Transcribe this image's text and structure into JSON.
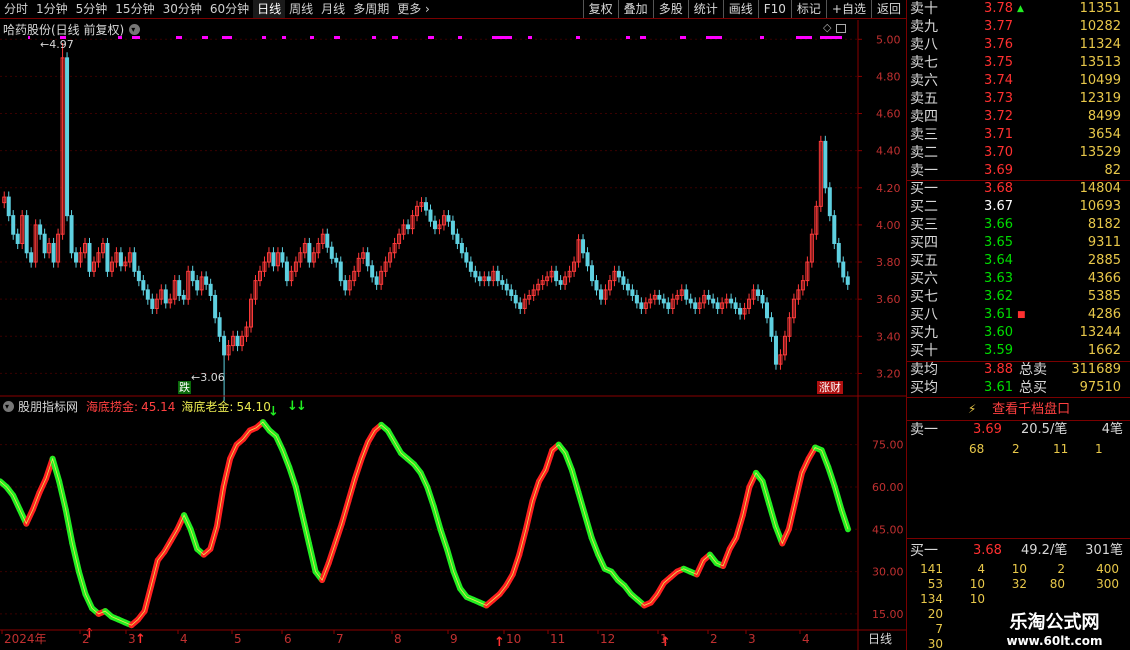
{
  "toolbar": {
    "timeframes": [
      "分时",
      "1分钟",
      "5分钟",
      "15分钟",
      "30分钟",
      "60分钟",
      "日线",
      "周线",
      "月线",
      "多周期",
      "更多"
    ],
    "active_timeframe": "日线",
    "buttons": [
      "复权",
      "叠加",
      "多股",
      "统计",
      "画线",
      "F10",
      "标记",
      "+自选",
      "返回"
    ]
  },
  "main": {
    "title": "哈药股份(日线 前复权)",
    "high_label": "4.97",
    "low_label": "3.06",
    "axis": [
      "5.00",
      "4.80",
      "4.60",
      "4.40",
      "4.20",
      "4.00",
      "3.80",
      "3.60",
      "3.40",
      "3.20"
    ],
    "tag_die": "跌",
    "tag_zhangcai": "涨财"
  },
  "indicator": {
    "name": "股朋指标网",
    "item1_label": "海底捞金:",
    "item1_value": "45.14",
    "item2_label": "海底老金:",
    "item2_value": "54.10",
    "axis": [
      "75.00",
      "60.00",
      "45.00",
      "30.00",
      "15.00"
    ]
  },
  "date_axis": {
    "labels": [
      "2024年",
      "2",
      "3",
      "4",
      "5",
      "6",
      "7",
      "8",
      "9",
      "10",
      "11",
      "12",
      "1",
      "2",
      "3",
      "4"
    ],
    "period": "日线"
  },
  "orderbook": {
    "asks": [
      {
        "label": "卖十",
        "price": "3.78",
        "vol": "11351",
        "mark": "▲"
      },
      {
        "label": "卖九",
        "price": "3.77",
        "vol": "10282"
      },
      {
        "label": "卖八",
        "price": "3.76",
        "vol": "11324"
      },
      {
        "label": "卖七",
        "price": "3.75",
        "vol": "13513"
      },
      {
        "label": "卖六",
        "price": "3.74",
        "vol": "10499"
      },
      {
        "label": "卖五",
        "price": "3.73",
        "vol": "12319"
      },
      {
        "label": "卖四",
        "price": "3.72",
        "vol": "8499"
      },
      {
        "label": "卖三",
        "price": "3.71",
        "vol": "3654"
      },
      {
        "label": "卖二",
        "price": "3.70",
        "vol": "13529"
      },
      {
        "label": "卖一",
        "price": "3.69",
        "vol": "82"
      }
    ],
    "bids": [
      {
        "label": "买一",
        "price": "3.68",
        "vol": "14804",
        "color": "red"
      },
      {
        "label": "买二",
        "price": "3.67",
        "vol": "10693",
        "color": "white"
      },
      {
        "label": "买三",
        "price": "3.66",
        "vol": "8182",
        "color": "green"
      },
      {
        "label": "买四",
        "price": "3.65",
        "vol": "9311",
        "color": "green"
      },
      {
        "label": "买五",
        "price": "3.64",
        "vol": "2885",
        "color": "green"
      },
      {
        "label": "买六",
        "price": "3.63",
        "vol": "4366",
        "color": "green"
      },
      {
        "label": "买七",
        "price": "3.62",
        "vol": "5385",
        "color": "green"
      },
      {
        "label": "买八",
        "price": "3.61",
        "vol": "4286",
        "color": "green",
        "mark": "■"
      },
      {
        "label": "买九",
        "price": "3.60",
        "vol": "13244",
        "color": "green"
      },
      {
        "label": "买十",
        "price": "3.59",
        "vol": "1662",
        "color": "green"
      }
    ],
    "avg_sell": {
      "label": "卖均",
      "price": "3.88",
      "tot_label": "总卖",
      "tot": "311689"
    },
    "avg_buy": {
      "label": "买均",
      "price": "3.61",
      "tot_label": "总买",
      "tot": "97510"
    },
    "view_button": "查看千档盘口",
    "sell1": {
      "label": "卖一",
      "price": "3.69",
      "per": "20.5/笔",
      "count": "4笔",
      "details": [
        "68",
        "2",
        "11",
        "1"
      ]
    },
    "buy1": {
      "label": "买一",
      "price": "3.68",
      "per": "49.2/笔",
      "count": "301笔"
    },
    "buy1_grid": [
      [
        "141",
        "4",
        "10",
        "2",
        "400"
      ],
      [
        "53",
        "10",
        "32",
        "80",
        "300"
      ],
      [
        "134",
        "10",
        "",
        "",
        ""
      ],
      [
        "20",
        "",
        "",
        "",
        ""
      ],
      [
        "7",
        "",
        "",
        "",
        ""
      ],
      [
        "30",
        "",
        "",
        "",
        ""
      ]
    ]
  },
  "watermark": {
    "line1": "乐淘公式网",
    "line2": "www.60lt.com"
  },
  "chart_data": [
    {
      "type": "candlestick",
      "title": "哈药股份(日线 前复权)",
      "ylim": [
        3.1,
        5.05
      ],
      "annotations": [
        {
          "text": "4.97",
          "x": "2024-01",
          "y": 4.97
        },
        {
          "text": "3.06",
          "x": "2024-02",
          "y": 3.06
        }
      ],
      "close_series": [
        4.15,
        4.05,
        3.95,
        3.9,
        4.05,
        3.85,
        3.8,
        4.0,
        3.95,
        3.85,
        3.9,
        3.8,
        3.95,
        4.9,
        4.05,
        3.85,
        3.8,
        3.85,
        3.9,
        3.75,
        3.8,
        3.85,
        3.9,
        3.75,
        3.8,
        3.85,
        3.78,
        3.8,
        3.85,
        3.75,
        3.7,
        3.65,
        3.6,
        3.55,
        3.6,
        3.65,
        3.58,
        3.6,
        3.7,
        3.62,
        3.6,
        3.75,
        3.7,
        3.65,
        3.72,
        3.68,
        3.62,
        3.5,
        3.4,
        3.3,
        3.35,
        3.4,
        3.35,
        3.4,
        3.45,
        3.6,
        3.7,
        3.75,
        3.8,
        3.85,
        3.78,
        3.85,
        3.8,
        3.7,
        3.75,
        3.8,
        3.85,
        3.9,
        3.8,
        3.85,
        3.9,
        3.95,
        3.88,
        3.82,
        3.8,
        3.7,
        3.65,
        3.7,
        3.75,
        3.82,
        3.85,
        3.78,
        3.72,
        3.68,
        3.75,
        3.8,
        3.85,
        3.9,
        3.95,
        4.0,
        3.98,
        4.05,
        4.1,
        4.12,
        4.08,
        4.02,
        3.98,
        4.0,
        4.05,
        4.02,
        3.95,
        3.9,
        3.85,
        3.8,
        3.75,
        3.72,
        3.7,
        3.72,
        3.7,
        3.75,
        3.7,
        3.68,
        3.65,
        3.62,
        3.58,
        3.55,
        3.6,
        3.62,
        3.65,
        3.68,
        3.7,
        3.72,
        3.75,
        3.7,
        3.68,
        3.72,
        3.75,
        3.8,
        3.92,
        3.85,
        3.78,
        3.7,
        3.65,
        3.6,
        3.65,
        3.7,
        3.75,
        3.72,
        3.68,
        3.65,
        3.62,
        3.58,
        3.55,
        3.58,
        3.6,
        3.62,
        3.6,
        3.58,
        3.55,
        3.6,
        3.62,
        3.65,
        3.6,
        3.58,
        3.55,
        3.58,
        3.62,
        3.6,
        3.58,
        3.55,
        3.58,
        3.6,
        3.58,
        3.55,
        3.52,
        3.55,
        3.6,
        3.65,
        3.62,
        3.58,
        3.5,
        3.4,
        3.25,
        3.3,
        3.4,
        3.5,
        3.6,
        3.65,
        3.7,
        3.8,
        3.95,
        4.1,
        4.45,
        4.2,
        4.05,
        3.9,
        3.8,
        3.72,
        3.68
      ]
    },
    {
      "type": "line",
      "title": "股朋指标网",
      "ylim": [
        10,
        88
      ],
      "series": [
        {
          "name": "海底捞金",
          "values": [
            62,
            60,
            57,
            52,
            47,
            52,
            58,
            63,
            70,
            62,
            52,
            40,
            30,
            22,
            17,
            15,
            16,
            14,
            13,
            12,
            11,
            13,
            16,
            25,
            34,
            37,
            41,
            45,
            50,
            45,
            38,
            36,
            38,
            46,
            60,
            70,
            75,
            77,
            80,
            81,
            83,
            80,
            78,
            73,
            67,
            60,
            50,
            40,
            30,
            27,
            33,
            40,
            47,
            55,
            63,
            70,
            76,
            80,
            82,
            80,
            76,
            72,
            70,
            68,
            65,
            60,
            53,
            45,
            38,
            30,
            24,
            21,
            20,
            19,
            18,
            20,
            22,
            25,
            29,
            36,
            45,
            55,
            62,
            66,
            73,
            75,
            72,
            66,
            58,
            50,
            42,
            36,
            31,
            30,
            27,
            25,
            22,
            20,
            18,
            19,
            22,
            26,
            28,
            30,
            31,
            30,
            29,
            34,
            36,
            33,
            32,
            38,
            42,
            50,
            60,
            65,
            62,
            54,
            46,
            40,
            45,
            55,
            65,
            70,
            74,
            73,
            67,
            60,
            52,
            45
          ]
        },
        {
          "name": "海底老金",
          "values": [
            62,
            60,
            57,
            52,
            47,
            52,
            58,
            63,
            70,
            62,
            52,
            40,
            30,
            22,
            17,
            15,
            16,
            14,
            13,
            12,
            11,
            13,
            16,
            25,
            34,
            37,
            41,
            45,
            50,
            45,
            38,
            36,
            38,
            46,
            60,
            70,
            75,
            77,
            80,
            81,
            83,
            80,
            78,
            73,
            67,
            60,
            50,
            40,
            30,
            27,
            33,
            40,
            47,
            55,
            63,
            70,
            76,
            80,
            82,
            80,
            76,
            72,
            70,
            68,
            65,
            60,
            53,
            45,
            38,
            30,
            24,
            21,
            20,
            19,
            18,
            20,
            22,
            25,
            29,
            36,
            45,
            55,
            62,
            66,
            73,
            75,
            72,
            66,
            58,
            50,
            42,
            36,
            31,
            30,
            27,
            25,
            22,
            20,
            18,
            19,
            22,
            26,
            28,
            30,
            31,
            30,
            29,
            34,
            36,
            33,
            32,
            38,
            42,
            50,
            60,
            65,
            62,
            54,
            46,
            40,
            45,
            55,
            65,
            70,
            74,
            73,
            67,
            60,
            52,
            45
          ]
        }
      ]
    }
  ]
}
